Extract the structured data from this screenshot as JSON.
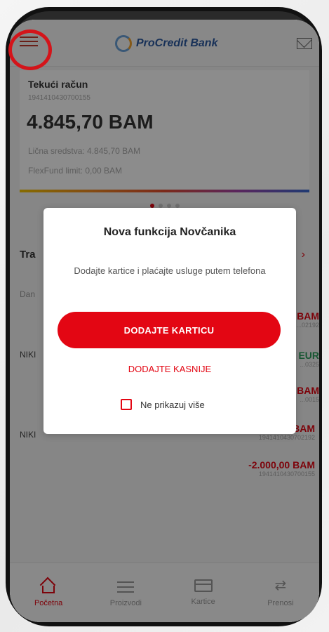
{
  "header": {
    "logo_text": "ProCredit Bank"
  },
  "account": {
    "name": "Tekući račun",
    "number": "1941410430700155",
    "balance": "4.845,70 BAM",
    "own_funds": "Lična sredstva:  4.845,70  BAM",
    "flexfund": "FlexFund limit:  0,00  BAM"
  },
  "transactions": {
    "title": "Tra",
    "date": "Dan",
    "items": [
      {
        "left": "",
        "amount": "BAM",
        "ref": "...02192",
        "color": "red"
      },
      {
        "left": "NIKI",
        "amount": "EUR",
        "ref": "...0325",
        "color": "green"
      },
      {
        "left": "",
        "amount": "BAM",
        "ref": "...0015",
        "color": "red"
      },
      {
        "left": "NIKI",
        "amount": "BAM",
        "ref": "1941410430702192",
        "color": "red"
      },
      {
        "left": "",
        "amount": "-2.000,00 BAM",
        "ref": "1941410430700155",
        "color": "red"
      }
    ]
  },
  "modal": {
    "title": "Nova funkcija Novčanika",
    "text": "Dodajte kartice i plaćajte usluge putem telefona",
    "primary_button": "DODAJTE KARTICU",
    "secondary_button": "DODAJTE KASNIJE",
    "checkbox_label": "Ne prikazuj više"
  },
  "tabbar": {
    "items": [
      {
        "label": "Početna",
        "icon": "home-icon",
        "active": true
      },
      {
        "label": "Proizvodi",
        "icon": "list-icon",
        "active": false
      },
      {
        "label": "Kartice",
        "icon": "card-icon",
        "active": false
      },
      {
        "label": "Prenosi",
        "icon": "transfer-icon",
        "active": false
      }
    ]
  },
  "colors": {
    "accent": "#e30613",
    "highlight_circle": "#d4141a"
  }
}
